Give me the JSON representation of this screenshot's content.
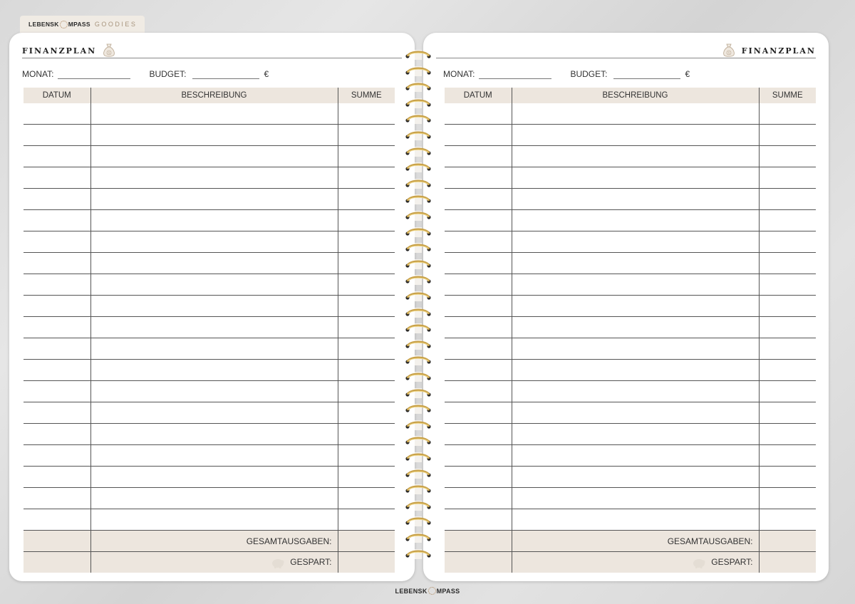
{
  "brand": {
    "name_part1": "LEBENSK",
    "name_part2": "MPASS",
    "tag": "GOODIES"
  },
  "pages": [
    {
      "title": "FINANZPLAN",
      "monat_label": "MONAT:",
      "budget_label": "BUDGET:",
      "currency": "€",
      "columns": [
        "DATUM",
        "BESCHREIBUNG",
        "SUMME"
      ],
      "row_count": 20,
      "total_label": "GESAMTAUSGABEN:",
      "saved_label": "GESPART:"
    },
    {
      "title": "FINANZPLAN",
      "monat_label": "MONAT:",
      "budget_label": "BUDGET:",
      "currency": "€",
      "columns": [
        "DATUM",
        "BESCHREIBUNG",
        "SUMME"
      ],
      "row_count": 20,
      "total_label": "GESAMTAUSGABEN:",
      "saved_label": "GESPART:"
    }
  ],
  "colors": {
    "accent": "#ede6de",
    "gold": "#c9a24a",
    "line": "#555555"
  },
  "icons": [
    "money-bag-icon",
    "piggy-bank-icon",
    "compass-logo-icon"
  ]
}
